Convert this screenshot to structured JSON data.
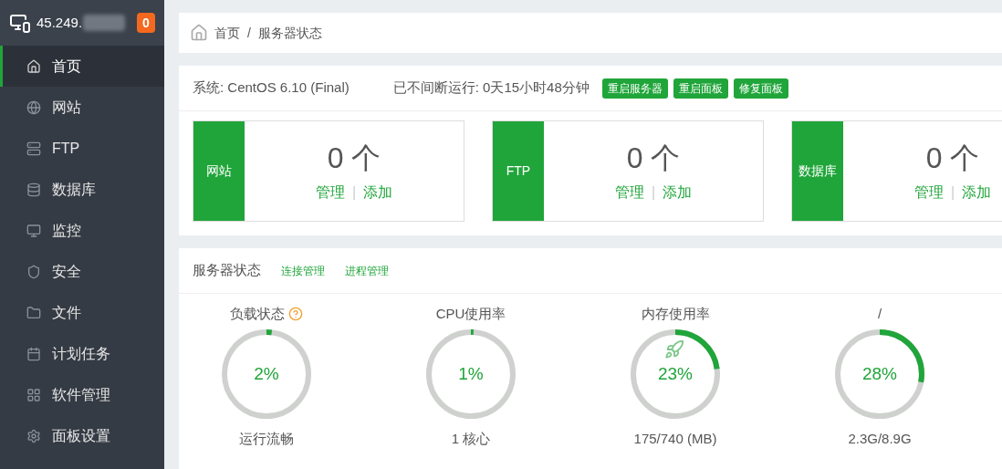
{
  "sidebar": {
    "host": "45.249.",
    "badge": "0",
    "items": [
      {
        "label": "首页",
        "selected": true
      },
      {
        "label": "网站",
        "selected": false
      },
      {
        "label": "FTP",
        "selected": false
      },
      {
        "label": "数据库",
        "selected": false
      },
      {
        "label": "监控",
        "selected": false
      },
      {
        "label": "安全",
        "selected": false
      },
      {
        "label": "文件",
        "selected": false
      },
      {
        "label": "计划任务",
        "selected": false
      },
      {
        "label": "软件管理",
        "selected": false
      },
      {
        "label": "面板设置",
        "selected": false
      }
    ]
  },
  "breadcrumb": [
    "首页",
    "/",
    "服务器状态"
  ],
  "system": {
    "os": "系统: CentOS 6.10 (Final)",
    "uptime": "已不间断运行: 0天15小时48分钟",
    "buttons": [
      "重启服务器",
      "重启面板",
      "修复面板"
    ]
  },
  "counters": [
    {
      "label": "网站",
      "count": "0 个",
      "manage": "管理",
      "separator": "|",
      "add": "添加"
    },
    {
      "label": "FTP",
      "count": "0 个",
      "manage": "管理",
      "separator": "|",
      "add": "添加"
    },
    {
      "label": "数据库",
      "count": "0 个",
      "manage": "管理",
      "separator": "|",
      "add": "添加"
    }
  ],
  "status": {
    "title": "服务器状态",
    "links": [
      "连接管理",
      "进程管理"
    ],
    "gauges": [
      {
        "title": "负载状态",
        "help": true,
        "rocket": false,
        "level": 0.02,
        "reading": "2%",
        "caption": "运行流畅"
      },
      {
        "title": "CPU使用率",
        "help": false,
        "rocket": false,
        "level": 0.01,
        "reading": "1%",
        "caption": "1 核心"
      },
      {
        "title": "内存使用率",
        "help": false,
        "rocket": true,
        "level": 0.23,
        "reading": "23%",
        "caption": "175/740 (MB)"
      },
      {
        "title": "/",
        "help": false,
        "rocket": false,
        "level": 0.28,
        "reading": "28%",
        "caption": "2.3G/8.9G"
      }
    ]
  }
}
